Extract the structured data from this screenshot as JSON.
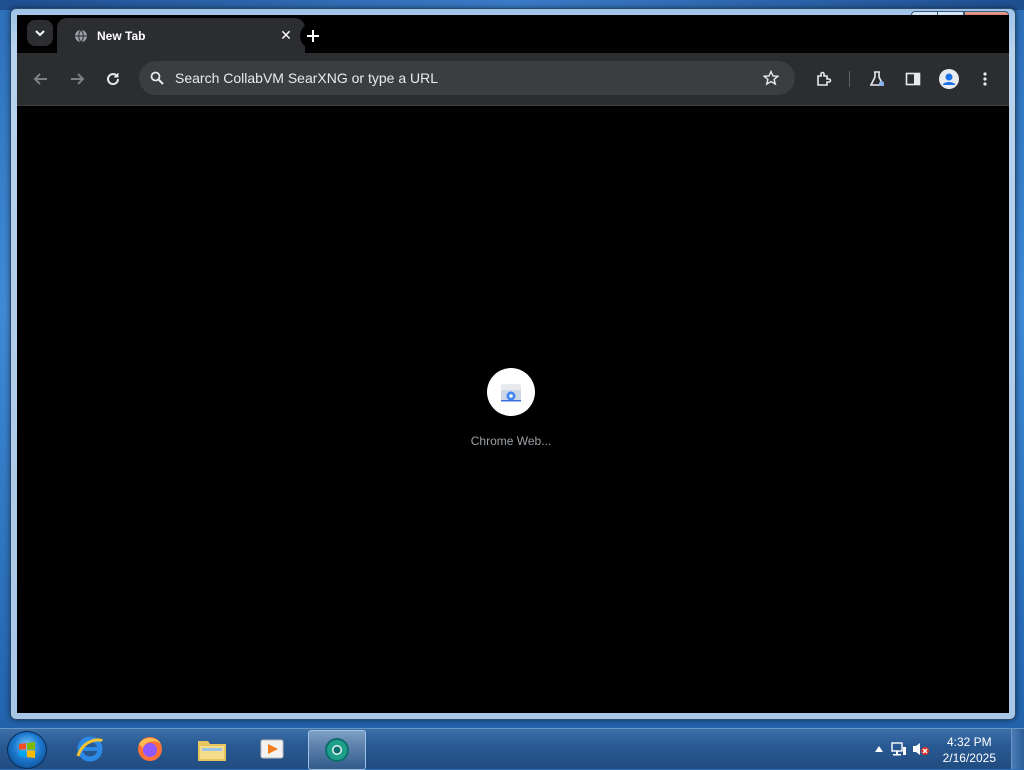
{
  "browser": {
    "tab": {
      "title": "New Tab"
    },
    "omnibox": {
      "placeholder": "Search CollabVM SearXNG or type a URL"
    },
    "new_tab_page": {
      "shortcuts": [
        {
          "label": "Chrome Web..."
        }
      ]
    }
  },
  "window_controls": {
    "minimize": "▁",
    "maximize": "▢",
    "close": "✕"
  },
  "taskbar": {
    "apps": [
      {
        "name": "internet-explorer-icon"
      },
      {
        "name": "firefox-icon"
      },
      {
        "name": "file-explorer-icon"
      },
      {
        "name": "media-player-icon"
      },
      {
        "name": "chrome-dev-icon",
        "active": true
      }
    ],
    "clock": {
      "time": "4:32 PM",
      "date": "2/16/2025"
    }
  },
  "colors": {
    "toolbar": "#2b2d30",
    "content_bg": "#000000",
    "taskbar": "#2a5a93"
  }
}
